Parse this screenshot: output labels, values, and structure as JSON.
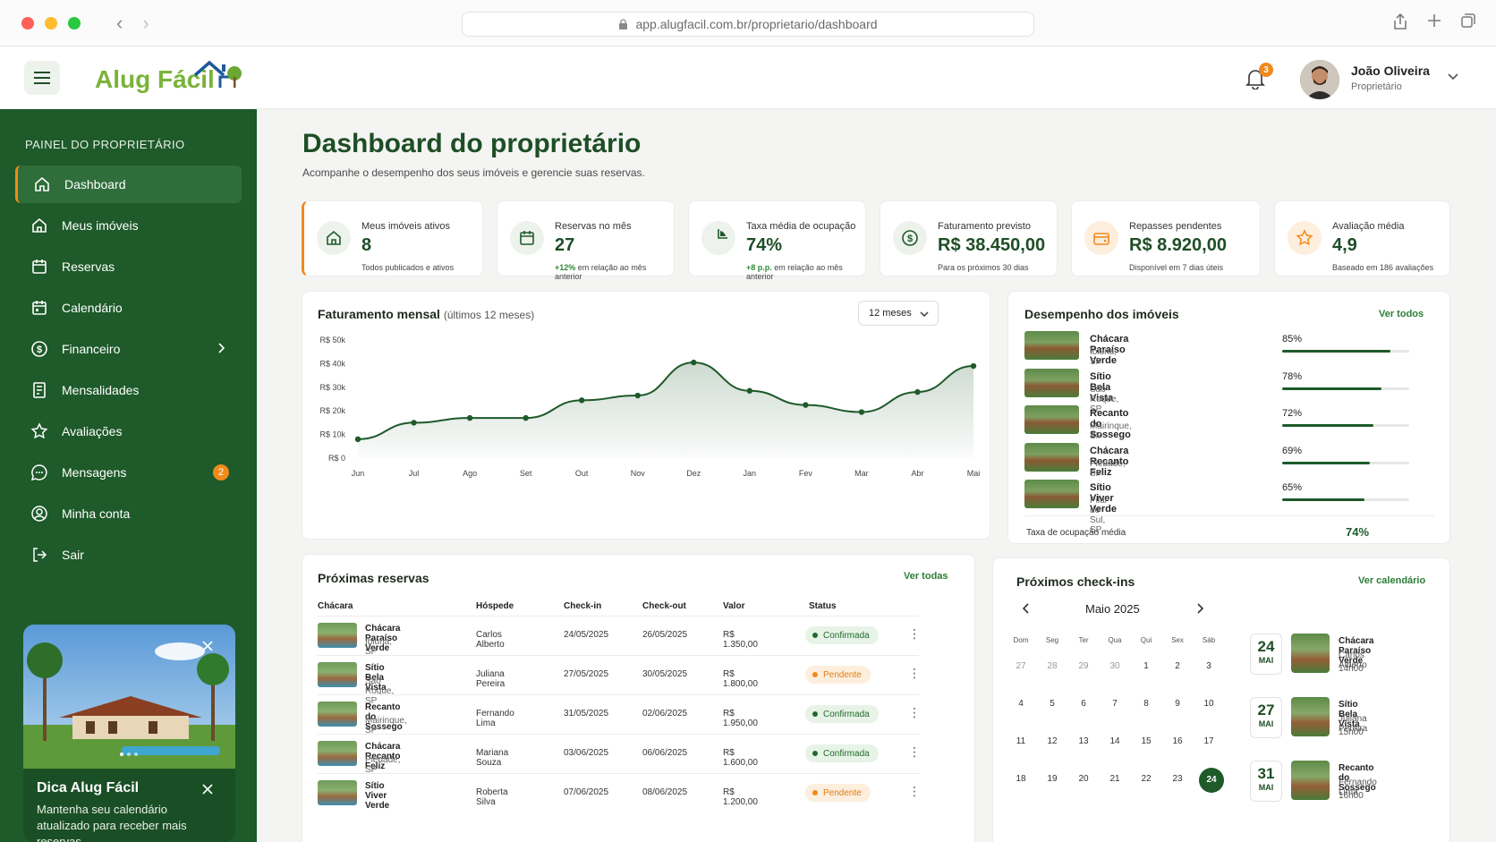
{
  "browser": {
    "url": "app.alugfacil.com.br/proprietario/dashboard"
  },
  "header": {
    "logo_text": "Alug Fácil",
    "notifications_count": "3",
    "user_name": "João Oliveira",
    "user_role": "Proprietário"
  },
  "sidebar": {
    "title": "PAINEL DO PROPRIETÁRIO",
    "items": [
      {
        "label": "Dashboard",
        "icon": "home-icon"
      },
      {
        "label": "Meus imóveis",
        "icon": "house-icon"
      },
      {
        "label": "Reservas",
        "icon": "calendar-icon"
      },
      {
        "label": "Calendário",
        "icon": "calendar-icon"
      },
      {
        "label": "Financeiro",
        "icon": "dollar-icon"
      },
      {
        "label": "Mensalidades",
        "icon": "receipt-icon"
      },
      {
        "label": "Avaliações",
        "icon": "star-icon"
      },
      {
        "label": "Mensagens",
        "icon": "chat-icon",
        "badge": "2"
      },
      {
        "label": "Minha conta",
        "icon": "user-icon"
      },
      {
        "label": "Sair",
        "icon": "logout-icon"
      }
    ],
    "tip": {
      "title": "Dica Alug Fácil",
      "text": "Mantenha seu calendário atualizado para receber mais reservas."
    }
  },
  "page": {
    "title": "Dashboard do proprietário",
    "subtitle": "Acompanhe o desempenho dos seus imóveis e gerencie suas reservas."
  },
  "stats": [
    {
      "label": "Meus imóveis ativos",
      "value": "8",
      "note": "Todos publicados e ativos",
      "note_highlight": ""
    },
    {
      "label": "Reservas no mês",
      "value": "27",
      "note_highlight": "+12%",
      "note": " em relação ao mês anterior"
    },
    {
      "label": "Taxa média de ocupação",
      "value": "74%",
      "note_highlight": "+8 p.p.",
      "note": " em relação ao mês anterior"
    },
    {
      "label": "Faturamento previsto",
      "value": "R$ 38.450,00",
      "note": "Para os próximos 30 dias",
      "note_highlight": ""
    },
    {
      "label": "Repasses pendentes",
      "value": "R$ 8.920,00",
      "note": "Disponível em 7 dias úteis",
      "note_highlight": ""
    },
    {
      "label": "Avaliação média",
      "value": "4,9",
      "note": "Baseado em 186 avaliações",
      "note_highlight": ""
    }
  ],
  "revenue": {
    "title": "Faturamento mensal",
    "title_suffix": "(últimos 12 meses)",
    "range_select": "12 meses"
  },
  "chart_data": {
    "type": "area",
    "categories": [
      "Jun",
      "Jul",
      "Ago",
      "Set",
      "Out",
      "Nov",
      "Dez",
      "Jan",
      "Fev",
      "Mar",
      "Abr",
      "Mai"
    ],
    "values": [
      8,
      15,
      17,
      17,
      24.5,
      26.5,
      40.5,
      28.5,
      22.5,
      19.5,
      28,
      39
    ],
    "yticks": [
      "R$ 0",
      "R$ 10k",
      "R$ 20k",
      "R$ 30k",
      "R$ 40k",
      "R$ 50k"
    ],
    "ylim": [
      0,
      50
    ],
    "color": "#1e5a2a"
  },
  "performance": {
    "title": "Desempenho dos imóveis",
    "link": "Ver todos",
    "items": [
      {
        "name": "Chácara Paraíso Verde",
        "loc": "Ibiúna, SP",
        "pct": "85%",
        "value": 85
      },
      {
        "name": "Sítio Bela Vista",
        "loc": "São Roque, SP",
        "pct": "78%",
        "value": 78
      },
      {
        "name": "Recanto do Sossego",
        "loc": "Mairinque, SP",
        "pct": "72%",
        "value": 72
      },
      {
        "name": "Chácara Recanto Feliz",
        "loc": "Piedade, SP",
        "pct": "69%",
        "value": 69
      },
      {
        "name": "Sítio Viver Verde",
        "loc": "Pilar do Sul, SP",
        "pct": "65%",
        "value": 65
      }
    ],
    "footer_label": "Taxa de ocupação média",
    "footer_value": "74%"
  },
  "reservations": {
    "title": "Próximas reservas",
    "link": "Ver todas",
    "headers": [
      "Chácara",
      "Hóspede",
      "Check-in",
      "Check-out",
      "Valor",
      "Status"
    ],
    "rows": [
      {
        "name": "Chácara Paraíso Verde",
        "loc": "Ibiúna, SP",
        "guest": "Carlos Alberto",
        "in": "24/05/2025",
        "out": "26/05/2025",
        "value": "R$ 1.350,00",
        "status": "Confirmada",
        "kind": "ok"
      },
      {
        "name": "Sítio Bela Vista",
        "loc": "São Roque, SP",
        "guest": "Juliana Pereira",
        "in": "27/05/2025",
        "out": "30/05/2025",
        "value": "R$ 1.800,00",
        "status": "Pendente",
        "kind": "pend"
      },
      {
        "name": "Recanto do Sossego",
        "loc": "Mairinque, SP",
        "guest": "Fernando Lima",
        "in": "31/05/2025",
        "out": "02/06/2025",
        "value": "R$ 1.950,00",
        "status": "Confirmada",
        "kind": "ok"
      },
      {
        "name": "Chácara Recanto Feliz",
        "loc": "Piedade, SP",
        "guest": "Mariana Souza",
        "in": "03/06/2025",
        "out": "06/06/2025",
        "value": "R$ 1.600,00",
        "status": "Confirmada",
        "kind": "ok"
      },
      {
        "name": "Sítio Viver Verde",
        "loc": "",
        "guest": "Roberta Silva",
        "in": "07/06/2025",
        "out": "08/06/2025",
        "value": "R$ 1.200,00",
        "status": "Pendente",
        "kind": "pend"
      }
    ]
  },
  "checkins": {
    "title": "Próximos check-ins",
    "link": "Ver calendário",
    "month": "Maio 2025",
    "dow": [
      "Dom",
      "Seg",
      "Ter",
      "Qua",
      "Qui",
      "Sex",
      "Sáb"
    ],
    "weeks": [
      [
        "27",
        "28",
        "29",
        "30",
        "1",
        "2",
        "3"
      ],
      [
        "4",
        "5",
        "6",
        "7",
        "8",
        "9",
        "10"
      ],
      [
        "11",
        "12",
        "13",
        "14",
        "15",
        "16",
        "17"
      ],
      [
        "18",
        "19",
        "20",
        "21",
        "22",
        "23",
        "24"
      ]
    ],
    "selected": "24",
    "items": [
      {
        "day": "24",
        "mon": "MAI",
        "name": "Chácara Paraíso Verde",
        "guest": "Carlos Alberto",
        "time": "14h00"
      },
      {
        "day": "27",
        "mon": "MAI",
        "name": "Sítio Bela Vista",
        "guest": "Juliana Pereira",
        "time": "15h00"
      },
      {
        "day": "31",
        "mon": "MAI",
        "name": "Recanto do Sossego",
        "guest": "Fernando Lima",
        "time": "16h00"
      }
    ]
  }
}
